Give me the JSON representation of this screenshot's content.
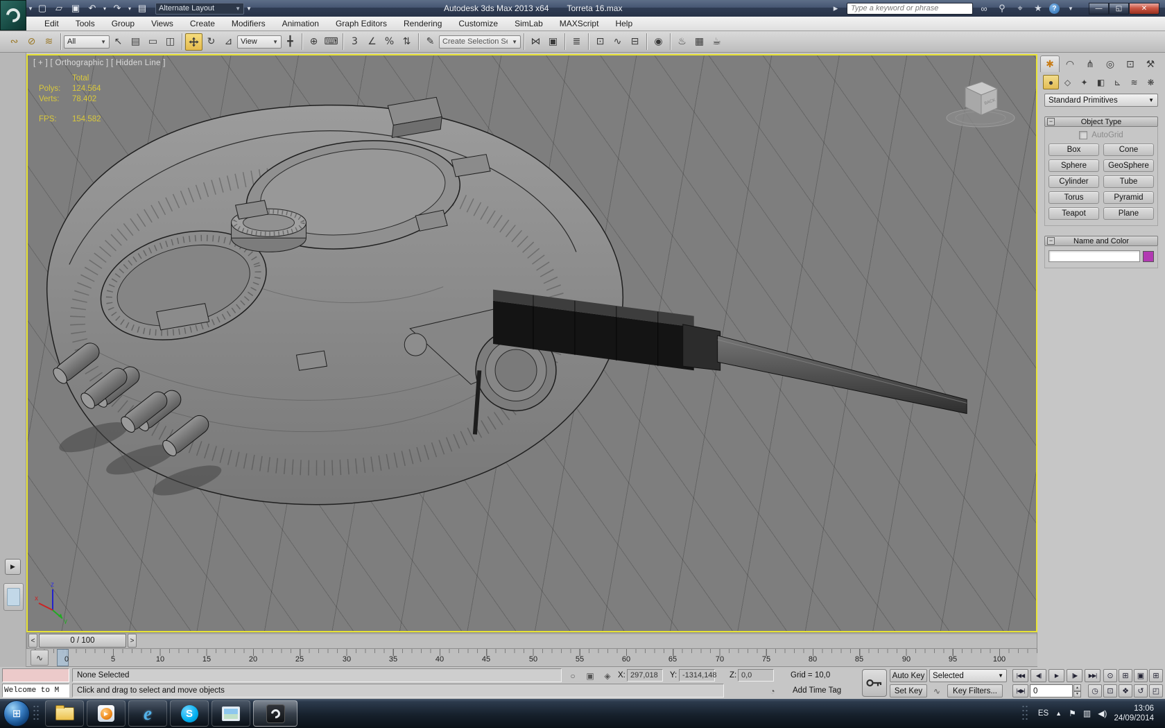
{
  "titlebar": {
    "title": "Autodesk 3ds Max  2013 x64",
    "filename": "Torreta 16.max",
    "workspace": "Alternate Layout",
    "search_placeholder": "Type a keyword or phrase"
  },
  "menubar": {
    "items": [
      "Edit",
      "Tools",
      "Group",
      "Views",
      "Create",
      "Modifiers",
      "Animation",
      "Graph Editors",
      "Rendering",
      "Customize",
      "SimLab",
      "MAXScript",
      "Help"
    ]
  },
  "toolbar": {
    "selection_filter": "All",
    "ref_coord": "View",
    "named_selection": "Create Selection Se"
  },
  "viewport": {
    "label": "[ + ] [ Orthographic ] [ Hidden Line ]",
    "viewcube_face": "BACK",
    "stats": {
      "total": "Total",
      "polys_label": "Polys:",
      "polys_value": "124.564",
      "verts_label": "Verts:",
      "verts_value": "78.402",
      "fps_label": "FPS:",
      "fps_value": "154.582"
    },
    "axis": {
      "x": "x",
      "y": "y",
      "z": "z"
    }
  },
  "command_panel": {
    "dropdown": "Standard Primitives",
    "rollout_object_type": "Object Type",
    "autogrid": "AutoGrid",
    "buttons": [
      "Box",
      "Cone",
      "Sphere",
      "GeoSphere",
      "Cylinder",
      "Tube",
      "Torus",
      "Pyramid",
      "Teapot",
      "Plane"
    ],
    "rollout_name_color": "Name and Color",
    "name_value": "",
    "swatch_color": "#b23ab2"
  },
  "timeslider": {
    "prev": "<",
    "value": "0 / 100",
    "next": ">"
  },
  "trackbar": {
    "labels": [
      "0",
      "5",
      "10",
      "15",
      "20",
      "25",
      "30",
      "35",
      "40",
      "45",
      "50",
      "55",
      "60",
      "65",
      "70",
      "75",
      "80",
      "85",
      "90",
      "95",
      "100"
    ]
  },
  "statusbar": {
    "listener_text": "Welcome to M",
    "selection": "None Selected",
    "prompt": "Click and drag to select and move objects",
    "x_label": "X:",
    "x_value": "297,018",
    "y_label": "Y:",
    "y_value": "-1314,148",
    "z_label": "Z:",
    "z_value": "0,0",
    "grid": "Grid = 10,0",
    "add_time_tag": "Add Time Tag",
    "auto_key": "Auto Key",
    "set_key": "Set Key",
    "key_mode": "Selected",
    "key_filters": "Key Filters...",
    "frame_value": "0"
  },
  "taskbar": {
    "language": "ES",
    "time": "13:06",
    "date": "24/09/2014"
  }
}
